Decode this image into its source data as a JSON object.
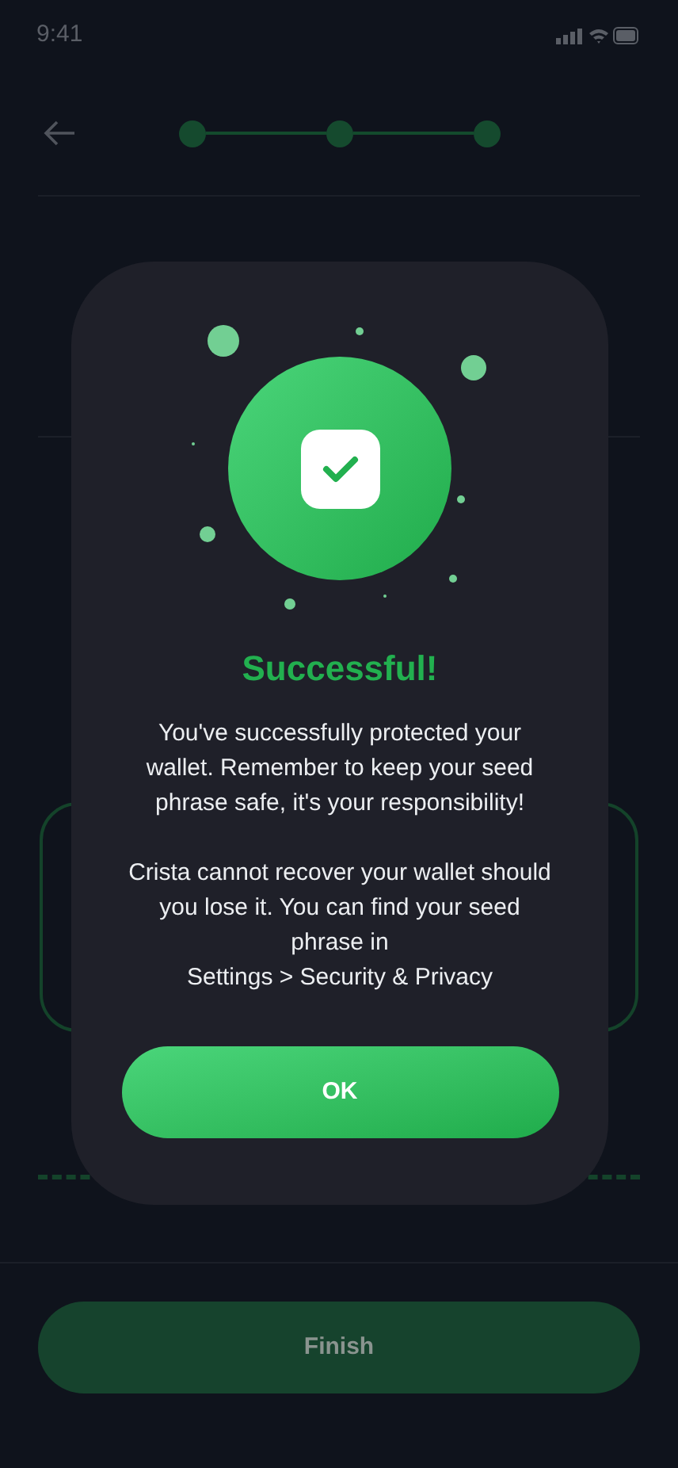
{
  "status_bar": {
    "time": "9:41"
  },
  "stepper": {
    "steps": [
      {
        "done": true
      },
      {
        "done": true
      },
      {
        "done": true
      }
    ]
  },
  "finish_button": {
    "label": "Finish",
    "disabled": true
  },
  "dialog": {
    "title": "Successful!",
    "paragraphs": [
      "You've successfully protected your wallet. Remember to keep your seed phrase safe, it's your responsibility!",
      "Crista cannot recover your wallet should you lose it. You can find your seed phrase in",
      "Settings > Security & Privacy"
    ],
    "button": "OK"
  }
}
